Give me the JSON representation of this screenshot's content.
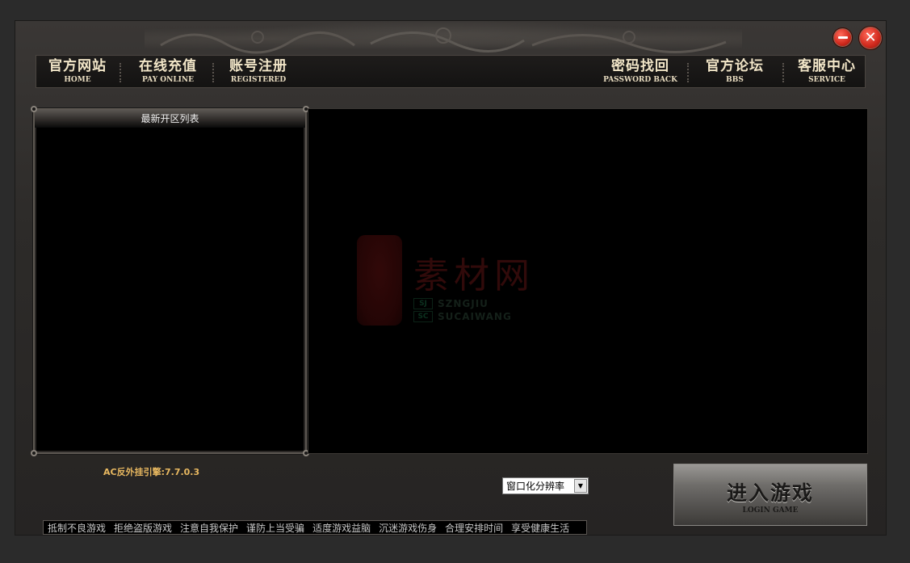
{
  "window": {
    "minimize_icon": "minus-icon",
    "close_icon": "x-icon",
    "minimize_color": "#d12a1e",
    "close_color": "#d12a1e"
  },
  "nav": {
    "home": {
      "cn": "官方网站",
      "en": "HOME"
    },
    "pay": {
      "cn": "在线充值",
      "en": "PAY ONLINE"
    },
    "register": {
      "cn": "账号注册",
      "en": "REGISTERED"
    },
    "password": {
      "cn": "密码找回",
      "en": "PASSWORD BACK"
    },
    "bbs": {
      "cn": "官方论坛",
      "en": "BBS"
    },
    "service": {
      "cn": "客服中心",
      "en": "SERVICE"
    }
  },
  "server_panel": {
    "title": "最新开区列表"
  },
  "watermark": {
    "title": "素材网",
    "badge1": "SJ",
    "badge2": "SC",
    "line1": "SZNGJIU",
    "line2": "SUCAIWANG"
  },
  "ac_version": "AC反外挂引擎:7.7.0.3",
  "resolution": {
    "selected": "窗口化分辨率"
  },
  "login": {
    "cn": "进入游戏",
    "en": "LOGIN GAME"
  },
  "health_notice": [
    "抵制不良游戏",
    "拒绝盗版游戏",
    "注意自我保护",
    "谨防上当受骗",
    "适度游戏益脑",
    "沉迷游戏伤身",
    "合理安排时间",
    "享受健康生活"
  ]
}
